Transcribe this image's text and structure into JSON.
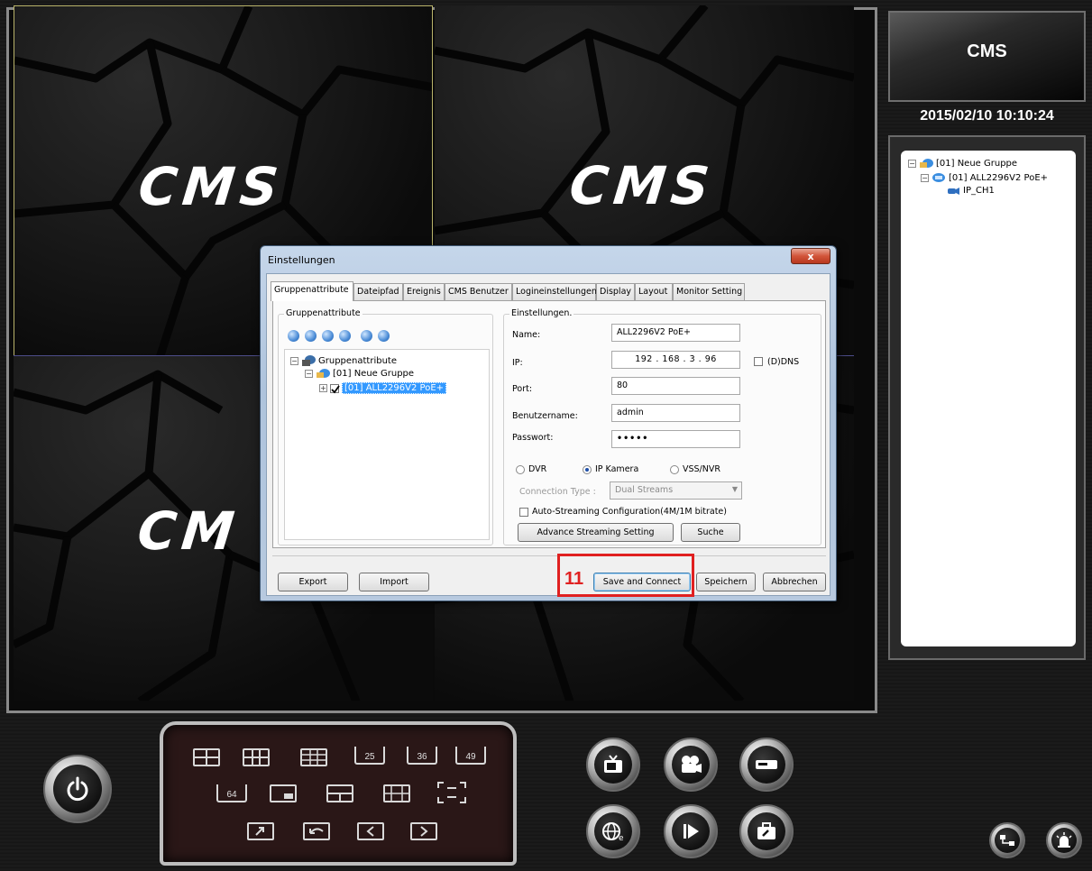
{
  "video_wall": {
    "watermark": "CMS",
    "cells": [
      {
        "watermark": "CMS"
      },
      {
        "watermark": "CMS"
      },
      {
        "watermark": "CM"
      },
      {
        "watermark": ""
      }
    ]
  },
  "header": {
    "logo_text": "CMS",
    "datetime": "2015/02/10 10:10:24"
  },
  "device_tree": {
    "group": "[01] Neue Gruppe",
    "device": "[01] ALL2296V2 PoE+",
    "channel": "IP_CH1"
  },
  "dialog": {
    "title": "Einstellungen",
    "close_label": "x",
    "tabs": [
      {
        "label": "Gruppenattribute",
        "active": true
      },
      {
        "label": "Dateipfad",
        "active": false
      },
      {
        "label": "Ereignis",
        "active": false
      },
      {
        "label": "CMS Benutzer",
        "active": false
      },
      {
        "label": "Logineinstellungen",
        "active": false
      },
      {
        "label": "Display",
        "active": false
      },
      {
        "label": "Layout",
        "active": false
      },
      {
        "label": "Monitor Setting",
        "active": false
      }
    ],
    "group_panel": {
      "legend": "Gruppenattribute",
      "tree": {
        "root": "Gruppenattribute",
        "group": "[01] Neue Gruppe",
        "device": "[01] ALL2296V2 PoE+"
      }
    },
    "settings_panel": {
      "legend": "Einstellungen.",
      "name_label": "Name:",
      "name_value": "ALL2296V2 PoE+",
      "ip_label": "IP:",
      "ip_value": "192 . 168 . 3 . 96",
      "ddns_label": "(D)DNS",
      "port_label": "Port:",
      "port_value": "80",
      "username_label": "Benutzername:",
      "username_value": "admin",
      "password_label": "Passwort:",
      "password_value": "•••••",
      "radio_dvr": "DVR",
      "radio_ipcam": "IP Kamera",
      "radio_vss": "VSS/NVR",
      "selected_type": "IP Kamera",
      "connection_type_label": "Connection Type :",
      "connection_type_value": "Dual Streams",
      "auto_streaming_label": "Auto-Streaming Configuration(4M/1M bitrate)",
      "advance_button": "Advance Streaming Setting",
      "search_button": "Suche"
    },
    "footer": {
      "export_button": "Export",
      "import_button": "Import",
      "save_connect_button": "Save and Connect",
      "save_button": "Speichern",
      "cancel_button": "Abbrechen"
    }
  },
  "annotation": {
    "step_number": "11",
    "color": "#e02020"
  },
  "layout_panel": {
    "icons_row1": [
      "layout-4-icon",
      "layout-6-icon",
      "layout-9-icon",
      "25",
      "36",
      "49"
    ],
    "icons_row2": [
      "64",
      "layout-pip-icon",
      "layout-split-icon",
      "layout-grid-icon",
      "fullscreen-icon"
    ],
    "icons_row3": [
      "popout-icon",
      "return-icon",
      "prev-icon",
      "next-icon"
    ]
  },
  "colors": {
    "accent_selection": "#3399ff",
    "annotation_red": "#e02020",
    "close_button_red": "#c84a2e"
  }
}
